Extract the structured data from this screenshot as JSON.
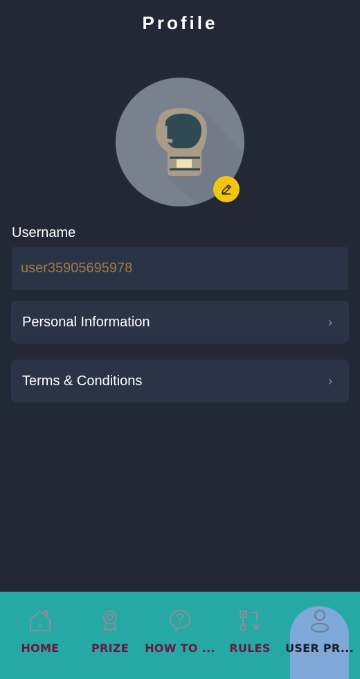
{
  "header": {
    "title": "Profile"
  },
  "profile": {
    "avatar_icon": "boxing-glove-icon",
    "edit_icon": "pencil-icon",
    "username_label": "Username",
    "username_value": "user35905695978"
  },
  "menu": {
    "items": [
      {
        "label": "Personal Information",
        "icon": "chevron-right-icon"
      },
      {
        "label": "Terms & Conditions",
        "icon": "chevron-right-icon"
      }
    ],
    "chevron": "›"
  },
  "bottom_nav": {
    "items": [
      {
        "label": "HOME",
        "icon": "home-icon",
        "active": false
      },
      {
        "label": "PRIZE",
        "icon": "award-icon",
        "active": false
      },
      {
        "label": "HOW TO ...",
        "icon": "help-icon",
        "active": false
      },
      {
        "label": "RULES",
        "icon": "rules-icon",
        "active": false
      },
      {
        "label": "USER PR...",
        "icon": "user-icon",
        "active": true
      }
    ]
  },
  "colors": {
    "background": "#222836",
    "card": "#2a3446",
    "nav": "#26a8a4",
    "nav_active": "#7da8d8",
    "edit_badge": "#f2c510",
    "username_text": "#9e7b47",
    "nav_label": "#6b1640"
  }
}
